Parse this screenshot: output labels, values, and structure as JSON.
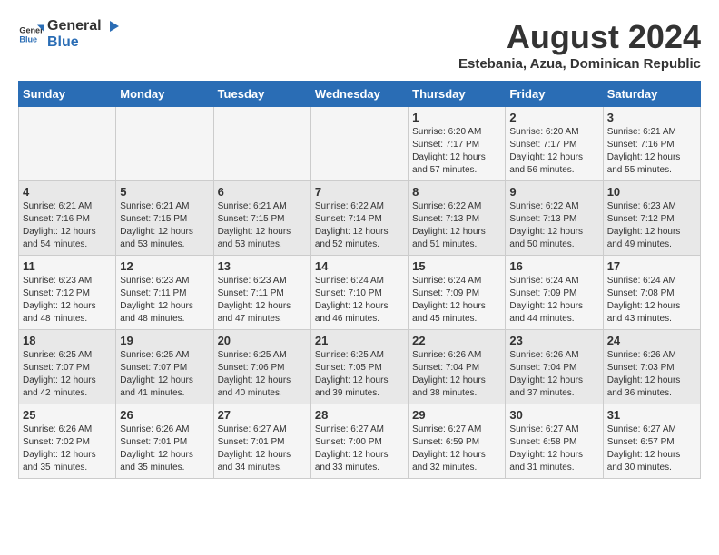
{
  "logo": {
    "general": "General",
    "blue": "Blue"
  },
  "title": "August 2024",
  "subtitle": "Estebania, Azua, Dominican Republic",
  "days_of_week": [
    "Sunday",
    "Monday",
    "Tuesday",
    "Wednesday",
    "Thursday",
    "Friday",
    "Saturday"
  ],
  "weeks": [
    {
      "days": [
        {
          "num": "",
          "info": ""
        },
        {
          "num": "",
          "info": ""
        },
        {
          "num": "",
          "info": ""
        },
        {
          "num": "",
          "info": ""
        },
        {
          "num": "1",
          "info": "Sunrise: 6:20 AM\nSunset: 7:17 PM\nDaylight: 12 hours\nand 57 minutes."
        },
        {
          "num": "2",
          "info": "Sunrise: 6:20 AM\nSunset: 7:17 PM\nDaylight: 12 hours\nand 56 minutes."
        },
        {
          "num": "3",
          "info": "Sunrise: 6:21 AM\nSunset: 7:16 PM\nDaylight: 12 hours\nand 55 minutes."
        }
      ]
    },
    {
      "days": [
        {
          "num": "4",
          "info": "Sunrise: 6:21 AM\nSunset: 7:16 PM\nDaylight: 12 hours\nand 54 minutes."
        },
        {
          "num": "5",
          "info": "Sunrise: 6:21 AM\nSunset: 7:15 PM\nDaylight: 12 hours\nand 53 minutes."
        },
        {
          "num": "6",
          "info": "Sunrise: 6:21 AM\nSunset: 7:15 PM\nDaylight: 12 hours\nand 53 minutes."
        },
        {
          "num": "7",
          "info": "Sunrise: 6:22 AM\nSunset: 7:14 PM\nDaylight: 12 hours\nand 52 minutes."
        },
        {
          "num": "8",
          "info": "Sunrise: 6:22 AM\nSunset: 7:13 PM\nDaylight: 12 hours\nand 51 minutes."
        },
        {
          "num": "9",
          "info": "Sunrise: 6:22 AM\nSunset: 7:13 PM\nDaylight: 12 hours\nand 50 minutes."
        },
        {
          "num": "10",
          "info": "Sunrise: 6:23 AM\nSunset: 7:12 PM\nDaylight: 12 hours\nand 49 minutes."
        }
      ]
    },
    {
      "days": [
        {
          "num": "11",
          "info": "Sunrise: 6:23 AM\nSunset: 7:12 PM\nDaylight: 12 hours\nand 48 minutes."
        },
        {
          "num": "12",
          "info": "Sunrise: 6:23 AM\nSunset: 7:11 PM\nDaylight: 12 hours\nand 48 minutes."
        },
        {
          "num": "13",
          "info": "Sunrise: 6:23 AM\nSunset: 7:11 PM\nDaylight: 12 hours\nand 47 minutes."
        },
        {
          "num": "14",
          "info": "Sunrise: 6:24 AM\nSunset: 7:10 PM\nDaylight: 12 hours\nand 46 minutes."
        },
        {
          "num": "15",
          "info": "Sunrise: 6:24 AM\nSunset: 7:09 PM\nDaylight: 12 hours\nand 45 minutes."
        },
        {
          "num": "16",
          "info": "Sunrise: 6:24 AM\nSunset: 7:09 PM\nDaylight: 12 hours\nand 44 minutes."
        },
        {
          "num": "17",
          "info": "Sunrise: 6:24 AM\nSunset: 7:08 PM\nDaylight: 12 hours\nand 43 minutes."
        }
      ]
    },
    {
      "days": [
        {
          "num": "18",
          "info": "Sunrise: 6:25 AM\nSunset: 7:07 PM\nDaylight: 12 hours\nand 42 minutes."
        },
        {
          "num": "19",
          "info": "Sunrise: 6:25 AM\nSunset: 7:07 PM\nDaylight: 12 hours\nand 41 minutes."
        },
        {
          "num": "20",
          "info": "Sunrise: 6:25 AM\nSunset: 7:06 PM\nDaylight: 12 hours\nand 40 minutes."
        },
        {
          "num": "21",
          "info": "Sunrise: 6:25 AM\nSunset: 7:05 PM\nDaylight: 12 hours\nand 39 minutes."
        },
        {
          "num": "22",
          "info": "Sunrise: 6:26 AM\nSunset: 7:04 PM\nDaylight: 12 hours\nand 38 minutes."
        },
        {
          "num": "23",
          "info": "Sunrise: 6:26 AM\nSunset: 7:04 PM\nDaylight: 12 hours\nand 37 minutes."
        },
        {
          "num": "24",
          "info": "Sunrise: 6:26 AM\nSunset: 7:03 PM\nDaylight: 12 hours\nand 36 minutes."
        }
      ]
    },
    {
      "days": [
        {
          "num": "25",
          "info": "Sunrise: 6:26 AM\nSunset: 7:02 PM\nDaylight: 12 hours\nand 35 minutes."
        },
        {
          "num": "26",
          "info": "Sunrise: 6:26 AM\nSunset: 7:01 PM\nDaylight: 12 hours\nand 35 minutes."
        },
        {
          "num": "27",
          "info": "Sunrise: 6:27 AM\nSunset: 7:01 PM\nDaylight: 12 hours\nand 34 minutes."
        },
        {
          "num": "28",
          "info": "Sunrise: 6:27 AM\nSunset: 7:00 PM\nDaylight: 12 hours\nand 33 minutes."
        },
        {
          "num": "29",
          "info": "Sunrise: 6:27 AM\nSunset: 6:59 PM\nDaylight: 12 hours\nand 32 minutes."
        },
        {
          "num": "30",
          "info": "Sunrise: 6:27 AM\nSunset: 6:58 PM\nDaylight: 12 hours\nand 31 minutes."
        },
        {
          "num": "31",
          "info": "Sunrise: 6:27 AM\nSunset: 6:57 PM\nDaylight: 12 hours\nand 30 minutes."
        }
      ]
    }
  ]
}
